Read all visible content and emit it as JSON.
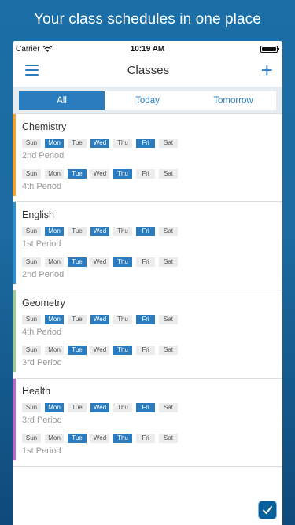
{
  "headline": "Your class schedules in one place",
  "status": {
    "carrier": "Carrier",
    "time": "10:19 AM",
    "battery_percent": 100
  },
  "nav": {
    "title": "Classes"
  },
  "tabs": [
    {
      "label": "All",
      "active": true
    },
    {
      "label": "Today",
      "active": false
    },
    {
      "label": "Tomorrow",
      "active": false
    }
  ],
  "day_names": [
    "Sun",
    "Mon",
    "Tue",
    "Wed",
    "Thu",
    "Fri",
    "Sat"
  ],
  "classes": [
    {
      "name": "Chemistry",
      "color": "#f0a33a",
      "schedules": [
        {
          "days": [
            false,
            true,
            false,
            true,
            false,
            true,
            false
          ],
          "period": "2nd Period"
        },
        {
          "days": [
            false,
            false,
            true,
            false,
            true,
            false,
            false
          ],
          "period": "4th Period"
        }
      ]
    },
    {
      "name": "English",
      "color": "#2e8fd0",
      "schedules": [
        {
          "days": [
            false,
            true,
            false,
            true,
            false,
            true,
            false
          ],
          "period": "1st Period"
        },
        {
          "days": [
            false,
            false,
            true,
            false,
            true,
            false,
            false
          ],
          "period": "2nd Period"
        }
      ]
    },
    {
      "name": "Geometry",
      "color": "#9ccc9b",
      "schedules": [
        {
          "days": [
            false,
            true,
            false,
            true,
            false,
            true,
            false
          ],
          "period": "4th Period"
        },
        {
          "days": [
            false,
            false,
            true,
            false,
            true,
            false,
            false
          ],
          "period": "3rd Period"
        }
      ]
    },
    {
      "name": "Health",
      "color": "#b56bc8",
      "schedules": [
        {
          "days": [
            false,
            true,
            false,
            true,
            false,
            true,
            false
          ],
          "period": "3rd Period"
        },
        {
          "days": [
            false,
            false,
            true,
            false,
            true,
            false,
            false
          ],
          "period": "1st Period"
        }
      ]
    }
  ],
  "colors": {
    "accent": "#2a7cbf",
    "inactive_day": "#ececec"
  },
  "icons": {
    "menu": "hamburger-icon",
    "add": "plus-icon",
    "wifi": "wifi-icon",
    "battery": "battery-icon",
    "app_badge": "checkmark-badge-icon"
  }
}
